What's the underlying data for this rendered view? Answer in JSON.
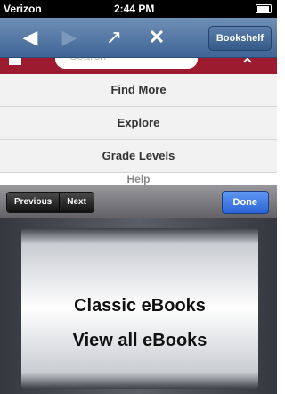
{
  "status_bar": {
    "carrier": "Verizon",
    "time": "2:44 PM"
  },
  "toolbar": {
    "back_icon": "back-arrow-icon",
    "forward_icon": "forward-arrow-icon",
    "share_icon": "share-icon",
    "close_icon": "close-icon",
    "bookshelf_label": "Bookshelf"
  },
  "banner": {
    "search_placeholder": "Search"
  },
  "menu": {
    "items": [
      "Find More",
      "Explore",
      "Grade Levels"
    ],
    "partially_hidden_item": "Help"
  },
  "keyboard_accessory": {
    "previous_label": "Previous",
    "next_label": "Next",
    "done_label": "Done"
  },
  "picker": {
    "options": [
      "Classic eBooks",
      "View all eBooks"
    ]
  },
  "colors": {
    "toolbar": "#4f74a3",
    "banner": "#9c1b2e",
    "done": "#2f6de0"
  }
}
